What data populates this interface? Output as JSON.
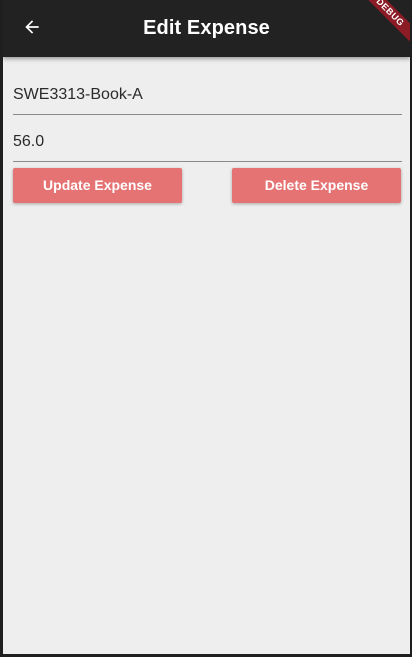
{
  "app_bar": {
    "title": "Edit Expense",
    "back_icon": "arrow-back-icon",
    "background": "#222222",
    "debug_banner": "DEBUG"
  },
  "form": {
    "name_field": {
      "value": "SWE3313-Book-A"
    },
    "amount_field": {
      "value": "56.0"
    }
  },
  "actions": {
    "update_label": "Update Expense",
    "delete_label": "Delete Expense",
    "button_color": "#e57373"
  },
  "page_background": "#eeeeee"
}
